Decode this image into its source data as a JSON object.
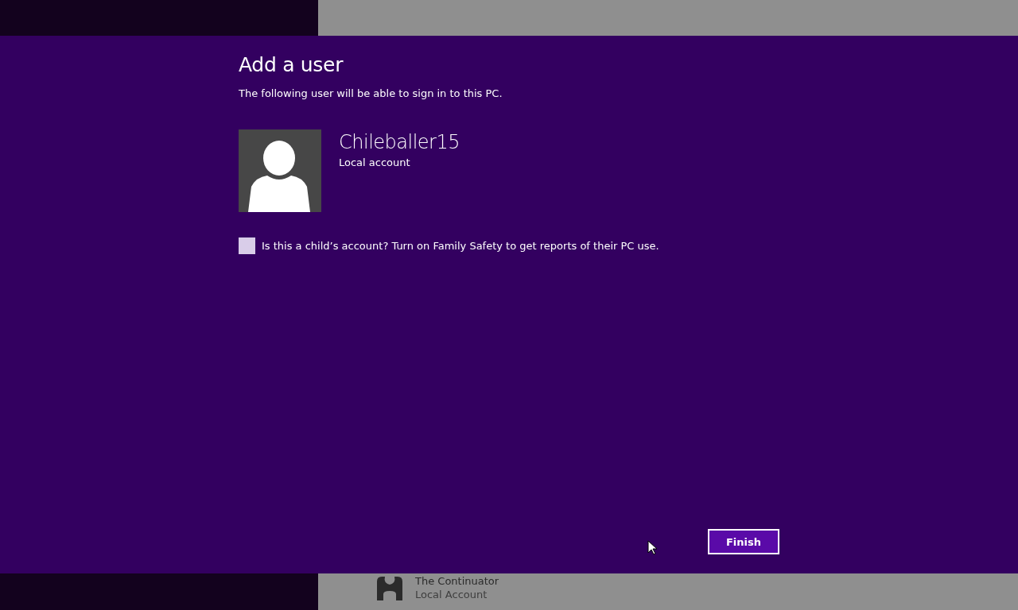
{
  "dialog": {
    "title": "Add a user",
    "subtitle": "The following user will be able to sign in to this PC.",
    "user": {
      "name": "Chileballer15",
      "account_type": "Local account"
    },
    "family_safety": {
      "label": "Is this a child’s account? Turn on Family Safety to get reports of their PC use.",
      "checked": false
    },
    "buttons": [
      "Finish"
    ]
  },
  "background_user": {
    "name": "The Continuator",
    "account_type": "Local Account"
  }
}
